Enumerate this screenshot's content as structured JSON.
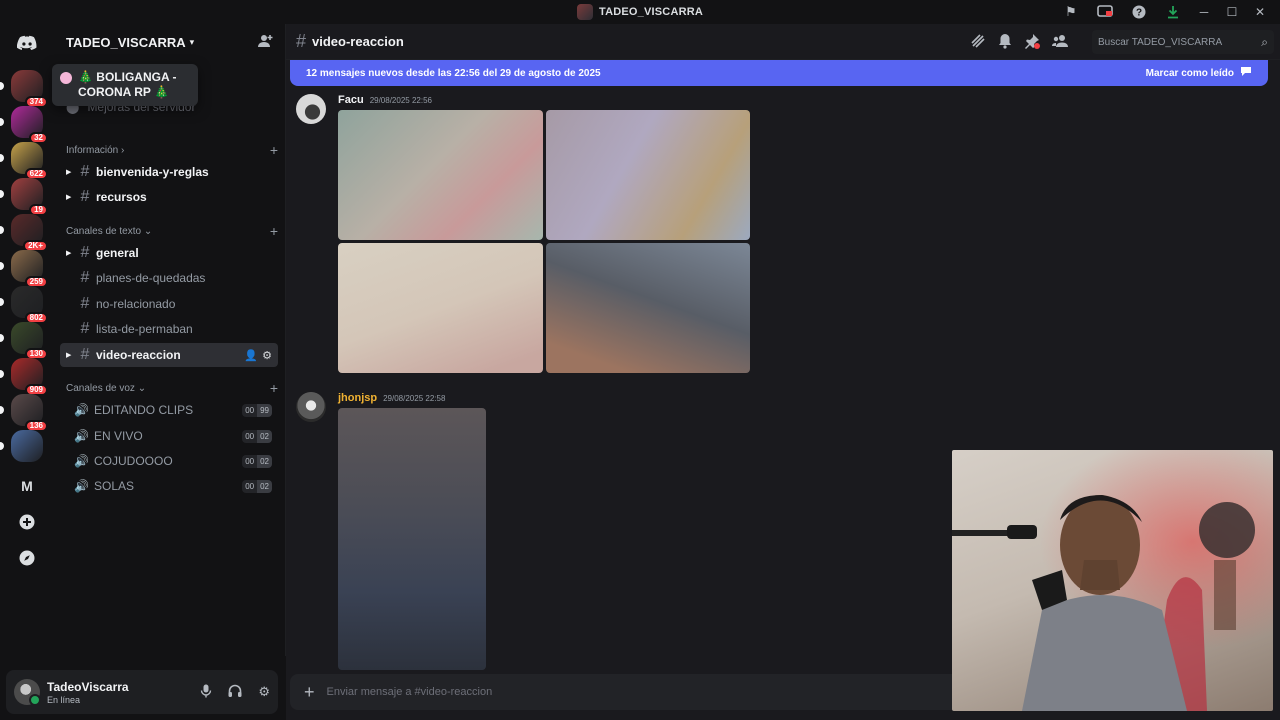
{
  "window": {
    "title": "TADEO_VISCARRA"
  },
  "rail": {
    "servers": [
      {
        "badge": "374",
        "color": "#8a3a3a"
      },
      {
        "badge": "32",
        "color": "#b02a9a"
      },
      {
        "badge": "622",
        "color": "#c6a24a"
      },
      {
        "badge": "19",
        "color": "#a04040"
      },
      {
        "badge": "2K+",
        "color": "#5a2a2a"
      },
      {
        "badge": "259",
        "color": "#8a6a4a"
      },
      {
        "badge": "802",
        "color": "#2a2a2a"
      },
      {
        "badge": "130",
        "color": "#3a4a2a"
      },
      {
        "badge": "909",
        "color": "#aa2a2a"
      },
      {
        "badge": "136",
        "color": "#5a4a4a"
      },
      {
        "badge": "",
        "color": "#4a6aa0"
      }
    ],
    "letter_server": "M"
  },
  "tooltip": {
    "line1": "🎄 BOLIGANGA -",
    "line2": "CORONA RP 🎄"
  },
  "server": {
    "name": "TADEO_VISCARRA",
    "boost_label": "Mejoras del servidor"
  },
  "categories": {
    "info": "Información",
    "text": "Canales de texto",
    "voice": "Canales de voz"
  },
  "channels": {
    "info": [
      {
        "name": "bienvenida-y-reglas"
      },
      {
        "name": "recursos"
      }
    ],
    "text": [
      {
        "name": "general"
      },
      {
        "name": "planes-de-quedadas"
      },
      {
        "name": "no-relacionado"
      },
      {
        "name": "lista-de-permaban"
      },
      {
        "name": "video-reaccion"
      }
    ],
    "voice": [
      {
        "name": "EDITANDO CLIPS",
        "users": "00",
        "limit": "99"
      },
      {
        "name": "EN VIVO",
        "users": "00",
        "limit": "02"
      },
      {
        "name": "COJUDOOOO",
        "users": "00",
        "limit": "02"
      },
      {
        "name": "SOLAS",
        "users": "00",
        "limit": "02"
      }
    ]
  },
  "user": {
    "name": "TadeoViscarra",
    "status": "En línea"
  },
  "header": {
    "channel": "video-reaccion",
    "search_placeholder": "Buscar TADEO_VISCARRA"
  },
  "newbar": {
    "text": "12 mensajes nuevos desde las 22:56 del 29 de agosto de 2025",
    "action": "Marcar como leído"
  },
  "messages": [
    {
      "author": "Facu",
      "time": "29/08/2025 22:56"
    },
    {
      "author": "jhonjsp",
      "time": "29/08/2025 22:58"
    }
  ],
  "composer": {
    "placeholder": "Enviar mensaje a #video-reaccion"
  }
}
